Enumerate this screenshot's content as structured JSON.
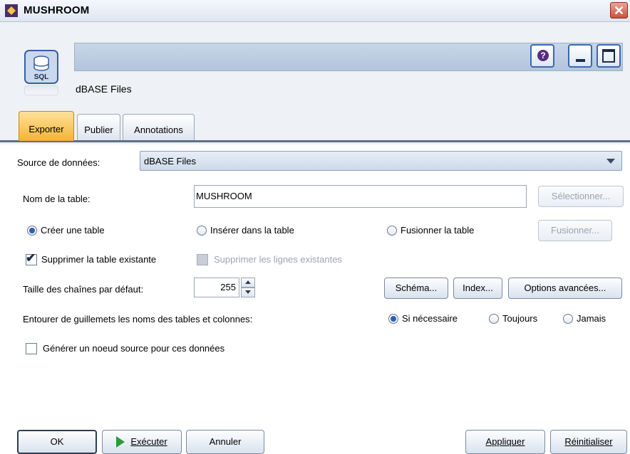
{
  "window": {
    "title": "MUSHROOM",
    "close_glyph": "✕"
  },
  "header": {
    "node_label": "dBASE Files",
    "node_icon_text": "SQL",
    "help_glyph": "?"
  },
  "tabs": [
    {
      "label": "Exporter",
      "active": true
    },
    {
      "label": "Publier",
      "active": false
    },
    {
      "label": "Annotations",
      "active": false
    }
  ],
  "form": {
    "datasource": {
      "label": "Source de données:",
      "value": "dBASE Files"
    },
    "tablename": {
      "label": "Nom de la table:",
      "value": "MUSHROOM",
      "select_button": "Sélectionner..."
    },
    "mode_radios": [
      {
        "label": "Créer une table",
        "checked": true
      },
      {
        "label": "Insérer dans la table",
        "checked": false
      },
      {
        "label": "Fusionner la table",
        "checked": false
      }
    ],
    "merge_button": "Fusionner...",
    "drop_table": {
      "label": "Supprimer la table existante",
      "checked": true
    },
    "delete_rows": {
      "label": "Supprimer les lignes existantes",
      "checked": false,
      "disabled": true
    },
    "string_size": {
      "label": "Taille des chaînes par défaut:",
      "value": "255"
    },
    "schema_button": "Schéma...",
    "index_button": "Index...",
    "advanced_button": "Options avancées...",
    "quote": {
      "label": "Entourer de guillemets les noms des tables et colonnes:",
      "options": [
        {
          "label": "Si nécessaire",
          "checked": true
        },
        {
          "label": "Toujours",
          "checked": false
        },
        {
          "label": "Jamais",
          "checked": false
        }
      ]
    },
    "generate_source": {
      "label": "Générer un noeud source pour ces données",
      "checked": false
    }
  },
  "footer": {
    "ok": "OK",
    "run": "Exécuter",
    "cancel": "Annuler",
    "apply": "Appliquer",
    "reset": "Réinitialiser"
  },
  "colors": {
    "accent_tab": "#f4b334",
    "radio_dot": "#2d5fb5",
    "run_icon": "#2c9a34"
  }
}
